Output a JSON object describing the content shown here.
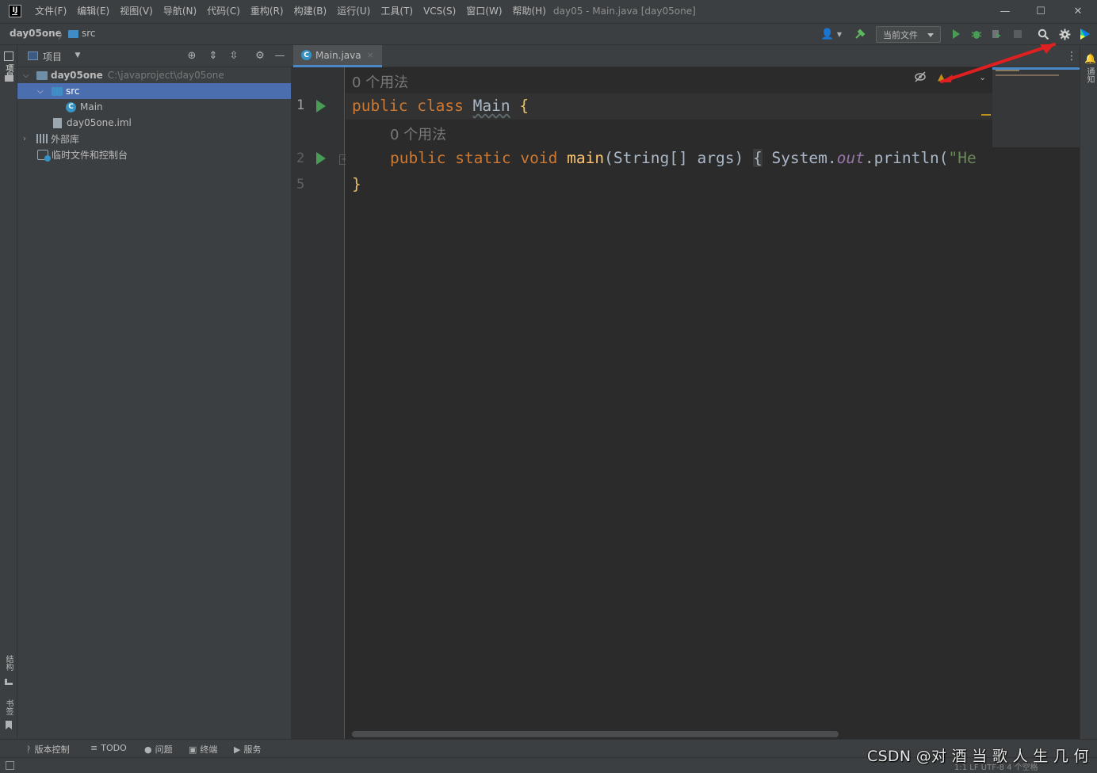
{
  "titlebar": {
    "logo_text": "IJ",
    "menu": [
      "文件(F)",
      "编辑(E)",
      "视图(V)",
      "导航(N)",
      "代码(C)",
      "重构(R)",
      "构建(B)",
      "运行(U)",
      "工具(T)",
      "VCS(S)",
      "窗口(W)",
      "帮助(H)"
    ],
    "window_title": "day05 - Main.java [day05one]",
    "minimize": "—",
    "maximize": "☐",
    "close": "✕"
  },
  "navbar": {
    "project": "day05one",
    "separator": "〉",
    "folder": "src",
    "run_config": "当前文件"
  },
  "left_stripe": {
    "project_tab": "项目",
    "structure_tab": "结构",
    "bookmarks_tab": "书签"
  },
  "right_stripe": {
    "notifications_tab": "通知"
  },
  "project_panel": {
    "title": "项目",
    "tree": [
      {
        "label": "day05one",
        "hint": "C:\\javaproject\\day05one",
        "kind": "module"
      },
      {
        "label": "src",
        "kind": "folder"
      },
      {
        "label": "Main",
        "kind": "class"
      },
      {
        "label": "day05one.iml",
        "kind": "file"
      },
      {
        "label": "外部库",
        "kind": "library"
      },
      {
        "label": "临时文件和控制台",
        "kind": "scratch"
      }
    ]
  },
  "editor": {
    "tab_label": "Main.java",
    "tab_close": "×",
    "inlay_usages_class": "0 个用法",
    "inlay_usages_method": "0 个用法",
    "line_numbers": [
      "1",
      "2",
      "5"
    ],
    "line1": {
      "kw1": "public",
      "kw2": "class",
      "name": "Main",
      "brace": "{"
    },
    "line2": {
      "kw1": "public",
      "kw2": "static",
      "kw3": "void",
      "method": "main",
      "params_open": "(String[] args)",
      "fold_brace": "{",
      "call_obj": "System.",
      "call_field": "out",
      "call_method": ".println(",
      "str": "\"He"
    },
    "line5": {
      "brace": "}"
    },
    "fold_marker": "+"
  },
  "bottom_tools": [
    {
      "icon": "git-branch-icon",
      "label": "版本控制"
    },
    {
      "icon": "list-icon",
      "label": "TODO"
    },
    {
      "icon": "problems-icon",
      "label": "问题"
    },
    {
      "icon": "terminal-icon",
      "label": "终端"
    },
    {
      "icon": "services-icon",
      "label": "服务"
    }
  ],
  "status": {
    "info": "1:1   LF   UTF-8   4 个空格"
  },
  "watermark": "CSDN @对 酒 当 歌 人 生 几 何",
  "colors": {
    "accent": "#4b6eaf",
    "run_green": "#499c54",
    "keyword": "#cc7832",
    "method": "#ffc66d",
    "arrow_red": "#e02020"
  }
}
